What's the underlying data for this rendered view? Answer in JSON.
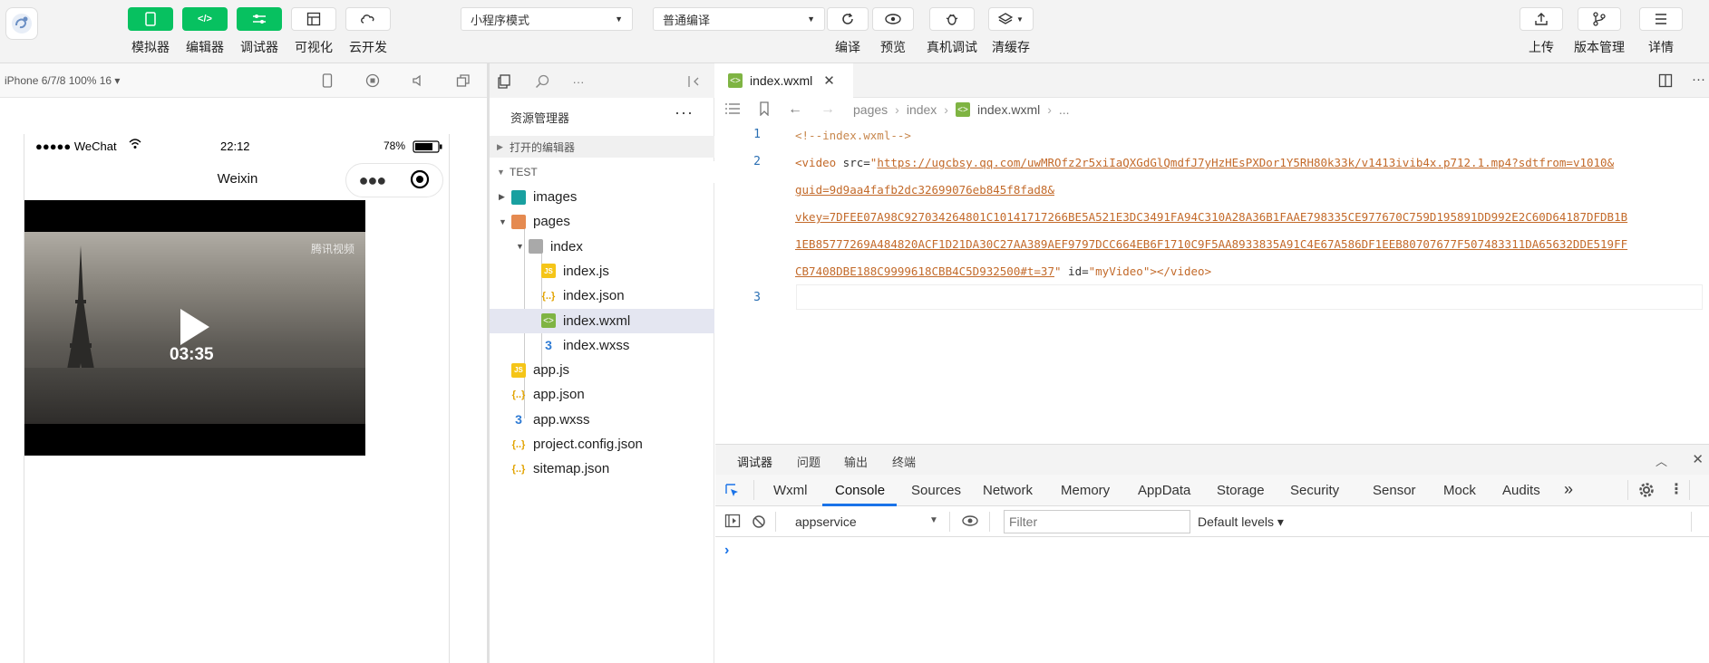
{
  "toolbar": {
    "buttons": [
      {
        "label": "模拟器",
        "icon": "phone-icon"
      },
      {
        "label": "编辑器",
        "icon": "code-icon"
      },
      {
        "label": "调试器",
        "icon": "sliders-icon"
      },
      {
        "label": "可视化",
        "icon": "layout-icon"
      },
      {
        "label": "云开发",
        "icon": "cloud-icon"
      }
    ],
    "mode_select": "小程序模式",
    "compile_select": "普通编译",
    "actions": [
      {
        "label": "编译",
        "icon": "refresh-icon"
      },
      {
        "label": "预览",
        "icon": "eye-icon"
      },
      {
        "label": "真机调试",
        "icon": "bug-icon"
      },
      {
        "label": "清缓存",
        "icon": "layers-icon"
      }
    ],
    "right_actions": [
      {
        "label": "上传",
        "icon": "upload-icon"
      },
      {
        "label": "版本管理",
        "icon": "branch-icon"
      },
      {
        "label": "详情",
        "icon": "menu-icon"
      }
    ]
  },
  "device": {
    "info": "iPhone 6/7/8 100% 16 ▾"
  },
  "phone": {
    "carrier": "●●●●● WeChat",
    "time": "22:12",
    "battery": "78%",
    "nav_title": "Weixin",
    "video_time": "03:35",
    "watermark": "腾讯视频"
  },
  "explorer": {
    "title": "资源管理器",
    "more": "···",
    "open_editors": "打开的编辑器",
    "project": "TEST",
    "items": [
      {
        "name": "images",
        "type": "folder-g",
        "depth": 1,
        "arrow": "▶"
      },
      {
        "name": "pages",
        "type": "folder-o",
        "depth": 1,
        "arrow": "▼"
      },
      {
        "name": "index",
        "type": "folder-p",
        "depth": 2,
        "arrow": "▼"
      },
      {
        "name": "index.js",
        "type": "js",
        "depth": 3,
        "arrow": ""
      },
      {
        "name": "index.json",
        "type": "json",
        "depth": 3,
        "arrow": ""
      },
      {
        "name": "index.wxml",
        "type": "wxml",
        "depth": 3,
        "arrow": "",
        "selected": true
      },
      {
        "name": "index.wxss",
        "type": "wxss",
        "depth": 3,
        "arrow": ""
      },
      {
        "name": "app.js",
        "type": "js",
        "depth": 1,
        "arrow": ""
      },
      {
        "name": "app.json",
        "type": "json",
        "depth": 1,
        "arrow": ""
      },
      {
        "name": "app.wxss",
        "type": "wxss",
        "depth": 1,
        "arrow": ""
      },
      {
        "name": "project.config.json",
        "type": "json",
        "depth": 1,
        "arrow": ""
      },
      {
        "name": "sitemap.json",
        "type": "json",
        "depth": 1,
        "arrow": ""
      }
    ]
  },
  "editor": {
    "tab_label": "index.wxml",
    "breadcrumb": [
      "pages",
      "index",
      "index.wxml",
      "..."
    ],
    "line_numbers": [
      "1",
      "2",
      "3"
    ],
    "code": {
      "comment": "<!--index.wxml-->",
      "tag_open": "<video",
      "attr_src": " src=",
      "quote": "\"",
      "url1": "https://ugcbsy.qq.com/uwMROfz2r5xiIaQXGdGlQmdfJ7yHzHEsPXDor1Y5RH80k33k/v1413ivib4x.p712.1.mp4?sdtfrom=v1010&",
      "url2": "guid=9d9aa4fafb2dc32699076eb845f8fad8&",
      "url3": "vkey=7DFEE07A98C927034264801C10141717266BE5A521E3DC3491FA94C310A28A36B1FAAE798335CE977670C759D195891DD992E2C60D64187DFDB1B",
      "url4": "1EB85777269A484820ACF1D21DA30C27AA389AEF9797DCC664EB6F1710C9F5AA8933835A91C4E67A586DF1EEB80707677F507483311DA65632DDE519FF",
      "url5": "CB7408DBE188C9999618CBB4C5D932500#t=37",
      "attr_id": " id=",
      "id_val": "\"myVideo\"",
      "tag_close": "></video>"
    }
  },
  "devtools": {
    "top_tabs": [
      "调试器",
      "问题",
      "输出",
      "终端"
    ],
    "tabs": [
      "Wxml",
      "Console",
      "Sources",
      "Network",
      "Memory",
      "AppData",
      "Storage",
      "Security",
      "Sensor",
      "Mock",
      "Audits"
    ],
    "more_tabs": "»",
    "context": "appservice",
    "filter_placeholder": "Filter",
    "levels": "Default levels ▾",
    "prompt": "›"
  }
}
